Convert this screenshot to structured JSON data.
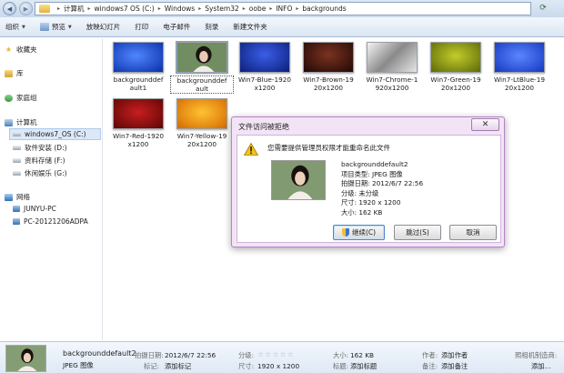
{
  "address_bar": {
    "crumbs": [
      "计算机",
      "windows7 OS (C:)",
      "Windows",
      "System32",
      "oobe",
      "INFO",
      "backgrounds"
    ]
  },
  "toolbar": {
    "organize": "组织",
    "preview": "预览",
    "slideshow": "放映幻灯片",
    "print": "打印",
    "email": "电子邮件",
    "burn": "刻录",
    "new_folder": "新建文件夹"
  },
  "nav": {
    "favorites": "收藏夹",
    "libraries": "库",
    "homegroup": "家庭组",
    "computer": "计算机",
    "drive_c": "windows7_OS (C:)",
    "drive_d": "软件安装 (D:)",
    "drive_f": "资料存储 (F:)",
    "drive_g": "休闲娱乐 (G:)",
    "network": "网络",
    "pc1": "JUNYU-PC",
    "pc2": "PC-20121206ADPA"
  },
  "files": [
    {
      "label": "backgrounddef\nault1",
      "color": "#1c4fd8"
    },
    {
      "label": "backgrounddef\nault",
      "color": "photo"
    },
    {
      "label": "Win7-Blue-1920\nx1200",
      "color": "#1430a8"
    },
    {
      "label": "Win7-Brown-19\n20x1200",
      "color": "#4a1a10"
    },
    {
      "label": "Win7-Chrome-1\n920x1200",
      "color": "#8a8a8a"
    },
    {
      "label": "Win7-Green-19\n20x1200",
      "color": "#8c9a12"
    },
    {
      "label": "Win7-LtBlue-19\n20x1200",
      "color": "#2a5ee0"
    },
    {
      "label": "Win7-Red-1920\nx1200",
      "color": "#9a1010"
    },
    {
      "label": "Win7-Yellow-19\n20x1200",
      "color": "#e89010"
    }
  ],
  "dialog": {
    "title": "文件访问被拒绝",
    "close": "✕",
    "message": "您需要提供管理员权限才能重命名此文件",
    "file_name": "backgrounddefault2",
    "item_type": "项目类型: JPEG 图像",
    "date_taken": "拍摄日期: 2012/6/7 22:56",
    "rating": "分级: 未分级",
    "dimensions": "尺寸: 1920 x 1200",
    "size": "大小: 162 KB",
    "continue_btn": "继续(C)",
    "skip_btn": "跳过(S)",
    "cancel_btn": "取消"
  },
  "details": {
    "name": "backgrounddefault2",
    "type": "JPEG 图像",
    "date_label": "拍摄日期:",
    "date_value": "2012/6/7 22:56",
    "tags_label": "标记:",
    "tags_value": "添加标记",
    "rating_label": "分级:",
    "rating_stars": "☆☆☆☆☆",
    "dim_label": "尺寸:",
    "dim_value": "1920 x 1200",
    "size_label": "大小:",
    "size_value": "162 KB",
    "title_label": "标题:",
    "title_value": "添加标题",
    "author_label": "作者:",
    "author_value": "添加作者",
    "comment_label": "备注:",
    "comment_value": "添加备注",
    "camera_label": "照相机制造商:",
    "camera_value": "添加..."
  }
}
